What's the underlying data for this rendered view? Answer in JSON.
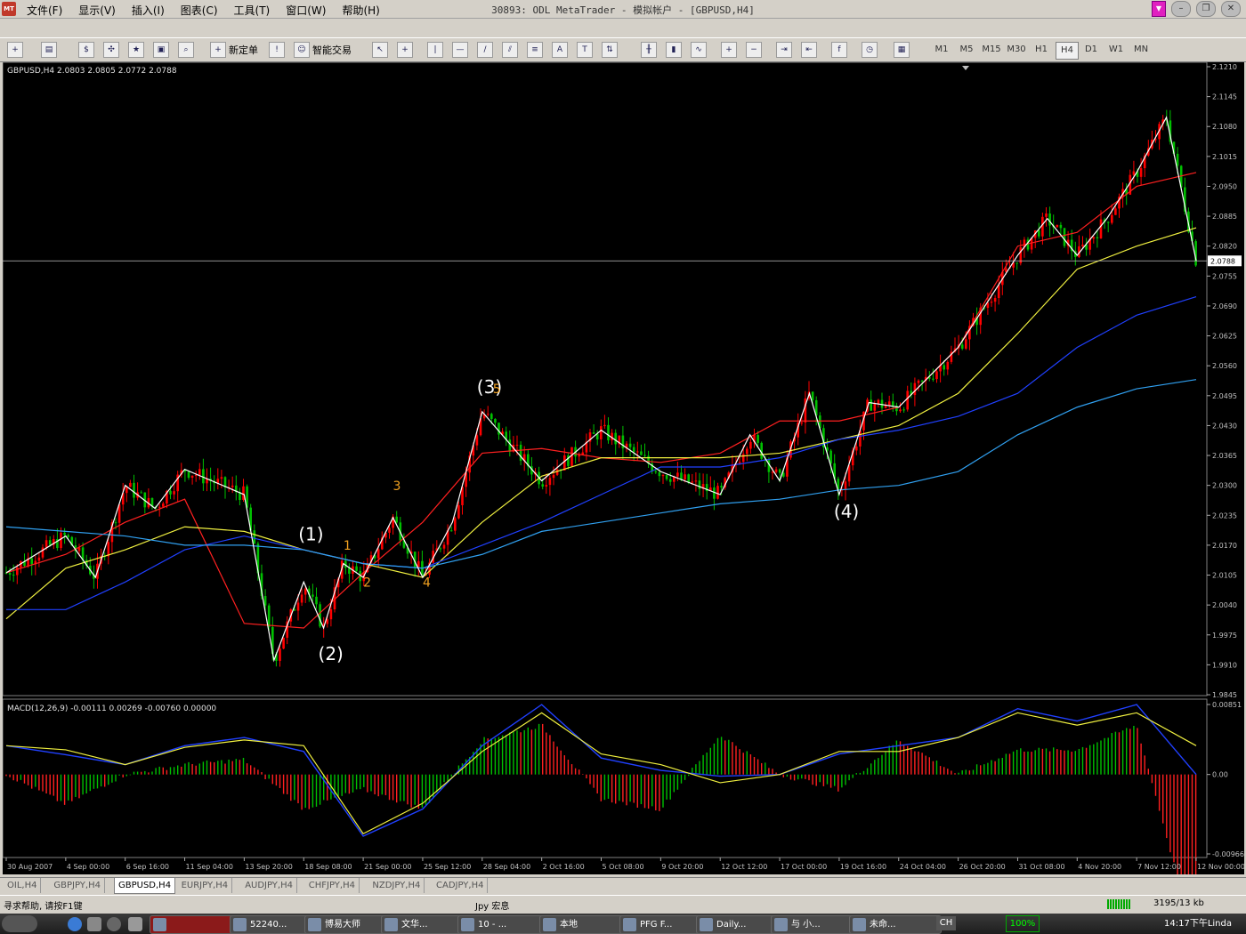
{
  "window": {
    "title": "30893: ODL MetaTrader - 模拟帐户 - [GBPUSD,H4]",
    "app_icon": "mt4-logo-icon",
    "menu": [
      "文件(F)",
      "显示(V)",
      "插入(I)",
      "图表(C)",
      "工具(T)",
      "窗口(W)",
      "帮助(H)"
    ]
  },
  "toolbar": {
    "new_order_label": "新定单",
    "expert_label": "智能交易",
    "timeframes": [
      "M1",
      "M5",
      "M15",
      "M30",
      "H1",
      "H4",
      "D1",
      "W1",
      "MN"
    ],
    "active_timeframe": "H4"
  },
  "chart": {
    "header": "GBPUSD,H4  2.0803 2.0805 2.0772 2.0788",
    "current_price_label": "2.0788",
    "price_ticks": [
      "2.1210",
      "2.1145",
      "2.1080",
      "2.1015",
      "2.0950",
      "2.0885",
      "2.0820",
      "2.0755",
      "2.0690",
      "2.0625",
      "2.0560",
      "2.0495",
      "2.0430",
      "2.0365",
      "2.0300",
      "2.0235",
      "2.0170",
      "2.0105",
      "2.0040",
      "1.9975",
      "1.9910",
      "1.9845"
    ],
    "macd_header": "MACD(12,26,9) -0.00111 0.00269 -0.00760 0.00000",
    "macd_ticks": [
      "0.00851",
      "0.00",
      "-0.00966"
    ],
    "time_labels": [
      "30 Aug 2007",
      "4 Sep 00:00",
      "6 Sep 16:00",
      "11 Sep 04:00",
      "13 Sep 20:00",
      "18 Sep 08:00",
      "21 Sep 00:00",
      "25 Sep 12:00",
      "28 Sep 04:00",
      "2 Oct 16:00",
      "5 Oct 08:00",
      "9 Oct 20:00",
      "12 Oct 12:00",
      "17 Oct 00:00",
      "19 Oct 16:00",
      "24 Oct 04:00",
      "26 Oct 20:00",
      "31 Oct 08:00",
      "4 Nov 20:00",
      "7 Nov 12:00",
      "12 Nov 00:00"
    ],
    "wave_labels": [
      "(1)",
      "(2)",
      "(3)",
      "(4)",
      "1",
      "2",
      "3",
      "4",
      "5"
    ]
  },
  "colors": {
    "background": "#000000",
    "bull_candle": "#ff0000",
    "bear_candle": "#00c000",
    "zigzag": "#ffffff",
    "ma_fast": "#ff2020",
    "ma_mid": "#f0f040",
    "ma_slow": "#2040ff",
    "ma_slowest": "#30a0f0",
    "macd_line": "#2040ff",
    "signal_line": "#f0f040",
    "wave_small": "#f0a020"
  },
  "tabs": [
    "OIL,H4",
    "GBPJPY,H4",
    "GBPUSD,H4",
    "EURJPY,H4",
    "AUDJPY,H4",
    "CHFJPY,H4",
    "NZDJPY,H4",
    "CADJPY,H4"
  ],
  "active_tab": "GBPUSD,H4",
  "status": {
    "help": "寻求帮助, 请按F1键",
    "profile": "Jpy 宏息",
    "traffic": "3195/13 kb"
  },
  "taskbar": {
    "items": [
      "52240...",
      "博易大师",
      "文华...",
      "10 - ...",
      "本地",
      "PFG F...",
      "Daily...",
      "与 小...",
      "未命..."
    ],
    "zoom": "100%",
    "lang": "CH",
    "clock": "14:17下午Linda"
  },
  "chart_data": {
    "type": "candlestick",
    "symbol": "GBPUSD",
    "timeframe": "H4",
    "ohlc_last": {
      "open": 2.0803,
      "high": 2.0805,
      "low": 2.0772,
      "close": 2.0788
    },
    "ylim": [
      1.9845,
      2.121
    ],
    "zigzag_points": [
      {
        "t": "30 Aug 2007",
        "price": 2.011
      },
      {
        "t": "4 Sep 00:00",
        "price": 2.019
      },
      {
        "t": "5 Sep 08:00",
        "price": 2.01
      },
      {
        "t": "7 Sep 08:00",
        "price": 2.03
      },
      {
        "t": "10 Sep 00:00",
        "price": 2.025
      },
      {
        "t": "11 Sep 04:00",
        "price": 2.0335
      },
      {
        "t": "13 Sep 20:00",
        "price": 2.028
      },
      {
        "t": "18 Sep 00:00",
        "price": 1.992
      },
      {
        "t": "18 Sep 08:00",
        "price": 2.009
      },
      {
        "t": "19 Sep 04:00",
        "price": 1.999
      },
      {
        "t": "20 Sep 00:00",
        "price": 2.013
      },
      {
        "t": "21 Sep 00:00",
        "price": 2.01
      },
      {
        "t": "22 Sep 00:00",
        "price": 2.023
      },
      {
        "t": "24 Sep 12:00",
        "price": 2.01
      },
      {
        "t": "26 Sep 08:00",
        "price": 2.022
      },
      {
        "t": "28 Sep 04:00",
        "price": 2.046
      },
      {
        "t": "2 Oct 16:00",
        "price": 2.031
      },
      {
        "t": "5 Oct 08:00",
        "price": 2.042
      },
      {
        "t": "9 Oct 20:00",
        "price": 2.033
      },
      {
        "t": "12 Oct 12:00",
        "price": 2.028
      },
      {
        "t": "15 Oct 12:00",
        "price": 2.041
      },
      {
        "t": "17 Oct 00:00",
        "price": 2.031
      },
      {
        "t": "18 Oct 12:00",
        "price": 2.05
      },
      {
        "t": "19 Oct 16:00",
        "price": 2.028
      },
      {
        "t": "22 Oct 04:00",
        "price": 2.048
      },
      {
        "t": "24 Oct 04:00",
        "price": 2.047
      },
      {
        "t": "26 Oct 20:00",
        "price": 2.06
      },
      {
        "t": "31 Oct 08:00",
        "price": 2.08
      },
      {
        "t": "2 Nov 04:00",
        "price": 2.088
      },
      {
        "t": "4 Nov 20:00",
        "price": 2.08
      },
      {
        "t": "5 Nov 20:00",
        "price": 2.088
      },
      {
        "t": "7 Nov 12:00",
        "price": 2.098
      },
      {
        "t": "9 Nov 00:00",
        "price": 2.11
      },
      {
        "t": "12 Nov 00:00",
        "price": 2.0788
      }
    ],
    "ma_series": [
      {
        "color": "#ff2020",
        "values": [
          2.011,
          2.015,
          2.022,
          2.027,
          2.0,
          1.999,
          2.011,
          2.022,
          2.037,
          2.038,
          2.036,
          2.035,
          2.037,
          2.044,
          2.044,
          2.047,
          2.06,
          2.082,
          2.085,
          2.095,
          2.098
        ]
      },
      {
        "color": "#f0f040",
        "values": [
          2.001,
          2.012,
          2.016,
          2.021,
          2.02,
          2.016,
          2.013,
          2.01,
          2.022,
          2.032,
          2.036,
          2.036,
          2.036,
          2.037,
          2.04,
          2.043,
          2.05,
          2.063,
          2.077,
          2.082,
          2.086
        ]
      },
      {
        "color": "#2040ff",
        "values": [
          2.003,
          2.003,
          2.009,
          2.016,
          2.019,
          2.016,
          2.013,
          2.012,
          2.017,
          2.022,
          2.028,
          2.034,
          2.034,
          2.036,
          2.04,
          2.042,
          2.045,
          2.05,
          2.06,
          2.067,
          2.071
        ]
      },
      {
        "color": "#30a0f0",
        "values": [
          2.021,
          2.02,
          2.019,
          2.017,
          2.017,
          2.016,
          2.013,
          2.012,
          2.015,
          2.02,
          2.022,
          2.024,
          2.026,
          2.027,
          2.029,
          2.03,
          2.033,
          2.041,
          2.047,
          2.051,
          2.053
        ]
      }
    ],
    "macd": {
      "ylim": [
        -0.00966,
        0.00851
      ],
      "last": {
        "macd": -0.00111,
        "signal": 0.00269,
        "hist": -0.0076
      },
      "macd_line": [
        0.0035,
        0.0024,
        0.0012,
        0.0035,
        0.0045,
        0.0028,
        -0.0075,
        -0.0042,
        0.0035,
        0.0085,
        0.002,
        0.0005,
        -0.0002,
        0.0,
        0.0025,
        0.0035,
        0.0045,
        0.008,
        0.0065,
        0.0085,
        0.0
      ],
      "signal_line": [
        0.0035,
        0.003,
        0.0012,
        0.0033,
        0.0042,
        0.0035,
        -0.0072,
        -0.0035,
        0.0028,
        0.0075,
        0.0025,
        0.0012,
        -0.001,
        0.0,
        0.0028,
        0.0028,
        0.0045,
        0.0075,
        0.006,
        0.0075,
        0.0035
      ]
    },
    "wave_annotations": [
      {
        "label": "(1)",
        "t": "18 Sep 08:00",
        "price": 2.018
      },
      {
        "label": "(2)",
        "t": "19 Sep 04:00",
        "price": 1.992
      },
      {
        "label": "(3)",
        "t": "28 Sep 04:00",
        "price": 2.05
      },
      {
        "label": "(4)",
        "t": "19 Oct 16:00",
        "price": 2.023
      },
      {
        "label": "1",
        "t": "20 Sep 00:00",
        "price": 2.016
      },
      {
        "label": "2",
        "t": "21 Sep 00:00",
        "price": 2.008
      },
      {
        "label": "3",
        "t": "22 Sep 00:00",
        "price": 2.029
      },
      {
        "label": "4",
        "t": "24 Sep 12:00",
        "price": 2.008
      },
      {
        "label": "5",
        "t": "28 Sep 04:00",
        "price": 2.05
      }
    ]
  }
}
